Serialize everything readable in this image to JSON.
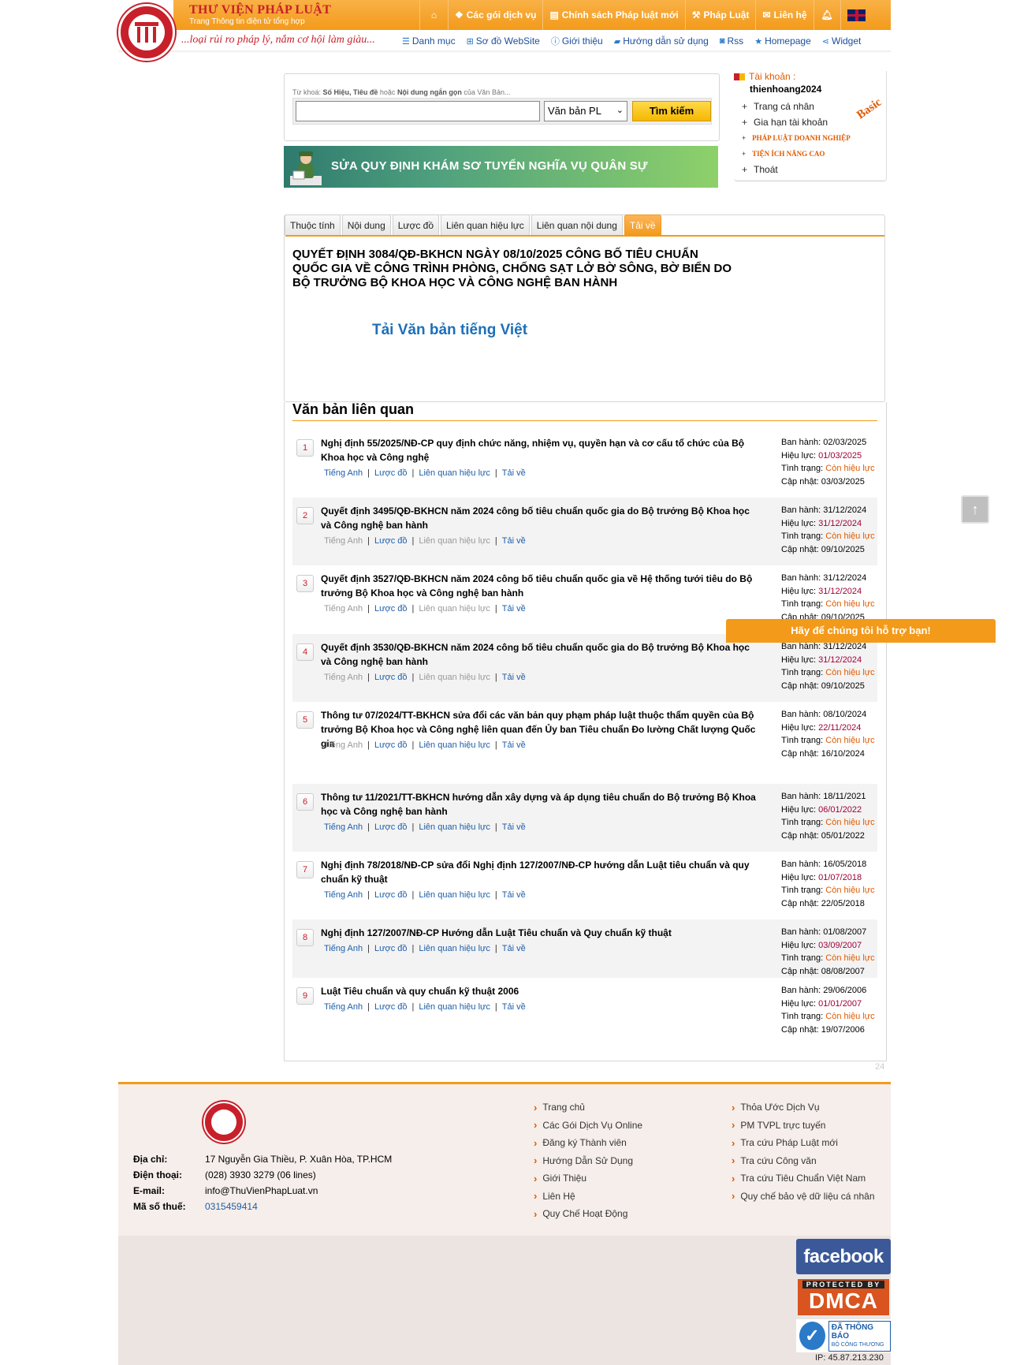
{
  "header": {
    "brand_title": "THƯ VIỆN PHÁP LUẬT",
    "brand_sub": "Trang Thông tin điện tử tổng hợp",
    "slogan": "...loại rủi ro pháp lý, nắm cơ hội làm giàu...",
    "topnav": [
      {
        "label": "",
        "icon": "home-icon"
      },
      {
        "label": "Các gói dịch vụ",
        "icon": "dropbox-icon"
      },
      {
        "label": "Chính sách Pháp luật mới",
        "icon": "news-icon"
      },
      {
        "label": "Pháp Luật",
        "icon": "gavel-icon"
      },
      {
        "label": "Liên hệ",
        "icon": "mail-icon"
      },
      {
        "label": "",
        "icon": "bell-icon"
      },
      {
        "label": "",
        "icon": "uk-flag-icon"
      }
    ],
    "subnav": [
      {
        "label": "Danh mục",
        "icon": "list-icon"
      },
      {
        "label": "Sơ đồ WebSite",
        "icon": "sitemap-icon"
      },
      {
        "label": "Giới thiệu",
        "icon": "info-icon"
      },
      {
        "label": "Hướng dẫn sử dụng",
        "icon": "book-icon"
      },
      {
        "label": "Rss",
        "icon": "rss-icon"
      },
      {
        "label": "Homepage",
        "icon": "star-icon"
      },
      {
        "label": "Widget",
        "icon": "share-icon"
      }
    ]
  },
  "search": {
    "hint_prefix": "Từ khoá: ",
    "hint_bold": "Số Hiệu, Tiêu đề",
    "hint_mid": " hoặc ",
    "hint_bold2": "Nội dung ngắn gọn",
    "hint_suffix": " của Văn Bản...",
    "value": "",
    "select_value": "Văn bản PL",
    "button_label": "Tìm kiếm"
  },
  "banner": {
    "text": "SỬA QUY ĐỊNH KHÁM SƠ TUYỂN NGHĨA VỤ QUÂN SỰ"
  },
  "account": {
    "label": "Tài khoản :",
    "username": "thienhoang2024",
    "badge": "Basic",
    "menu": [
      {
        "label": "Trang cá nhân",
        "style": "normal"
      },
      {
        "label": "Gia hạn tài khoản",
        "style": "normal"
      },
      {
        "label": "PHÁP LUẬT DOANH NGHIỆP",
        "style": "red"
      },
      {
        "label": "TIỆN ÍCH NÂNG CAO",
        "style": "red"
      },
      {
        "label": "Thoát",
        "style": "normal"
      }
    ]
  },
  "tabs": [
    {
      "label": "Thuộc tính",
      "active": false
    },
    {
      "label": "Nội dung",
      "active": false
    },
    {
      "label": "Lược đồ",
      "active": false
    },
    {
      "label": "Liên quan hiệu lực",
      "active": false
    },
    {
      "label": "Liên quan nội dung",
      "active": false
    },
    {
      "label": "Tải về",
      "active": true
    }
  ],
  "document": {
    "title": "QUYẾT ĐỊNH 3084/QĐ-BKHCN NGÀY 08/10/2025 CÔNG BỐ TIÊU CHUẨN QUỐC GIA VỀ CÔNG TRÌNH PHÒNG, CHỐNG SẠT LỞ BỜ SÔNG, BỜ BIỂN DO BỘ TRƯỞNG BỘ KHOA HỌC VÀ CÔNG NGHỆ BAN HÀNH",
    "download_label": "Tải Văn bản tiếng Việt"
  },
  "related": {
    "heading": "Văn bản liên quan",
    "meta_labels": {
      "issued": "Ban hành:",
      "effective": "Hiệu lực:",
      "status": "Tình trạng:",
      "updated": "Cập nhật:"
    },
    "link_labels": {
      "en": "Tiếng Anh",
      "diagram": "Lược đồ",
      "effect": "Liên quan hiệu lực",
      "download": "Tải về"
    },
    "items": [
      {
        "num": "1",
        "title": "Nghị định 55/2025/NĐ-CP quy định chức năng, nhiệm vụ, quyền hạn và cơ cấu tổ chức của Bộ Khoa học và Công nghệ",
        "issued": "02/03/2025",
        "effective": "01/03/2025",
        "status": "Còn hiệu lực",
        "updated": "03/03/2025",
        "en_dim": false,
        "effect_dim": false
      },
      {
        "num": "2",
        "title": "Quyết định 3495/QĐ-BKHCN năm 2024 công bố tiêu chuẩn quốc gia do Bộ trưởng Bộ Khoa học và Công nghệ ban hành",
        "issued": "31/12/2024",
        "effective": "31/12/2024",
        "status": "Còn hiệu lực",
        "updated": "09/10/2025",
        "en_dim": true,
        "effect_dim": true
      },
      {
        "num": "3",
        "title": "Quyết định 3527/QĐ-BKHCN năm 2024 công bố tiêu chuẩn quốc gia về Hệ thống tưới tiêu do Bộ trưởng Bộ Khoa học và Công nghệ ban hành",
        "issued": "31/12/2024",
        "effective": "31/12/2024",
        "status": "Còn hiệu lực",
        "updated": "09/10/2025",
        "en_dim": true,
        "effect_dim": true
      },
      {
        "num": "4",
        "title": "Quyết định 3530/QĐ-BKHCN năm 2024 công bố tiêu chuẩn quốc gia do Bộ trưởng Bộ Khoa học và Công nghệ ban hành",
        "issued": "31/12/2024",
        "effective": "31/12/2024",
        "status": "Còn hiệu lực",
        "updated": "09/10/2025",
        "en_dim": true,
        "effect_dim": true
      },
      {
        "num": "5",
        "title": "Thông tư 07/2024/TT-BKHCN sửa đổi các văn bản quy phạm pháp luật thuộc thẩm quyền của Bộ trưởng Bộ Khoa học và Công nghệ liên quan đến Ủy ban Tiêu chuẩn Đo lường Chất lượng Quốc gia",
        "issued": "08/10/2024",
        "effective": "22/11/2024",
        "status": "Còn hiệu lực",
        "updated": "16/10/2024",
        "en_dim": true,
        "effect_dim": false
      },
      {
        "num": "6",
        "title": "Thông tư 11/2021/TT-BKHCN hướng dẫn xây dựng và áp dụng tiêu chuẩn do Bộ trưởng Bộ Khoa học và Công nghệ ban hành",
        "issued": "18/11/2021",
        "effective": "06/01/2022",
        "status": "Còn hiệu lực",
        "updated": "05/01/2022",
        "en_dim": false,
        "effect_dim": false
      },
      {
        "num": "7",
        "title": "Nghị định 78/2018/NĐ-CP sửa đổi Nghị định 127/2007/NĐ-CP hướng dẫn Luật tiêu chuẩn và quy chuẩn kỹ thuật",
        "issued": "16/05/2018",
        "effective": "01/07/2018",
        "status": "Còn hiệu lực",
        "updated": "22/05/2018",
        "en_dim": false,
        "effect_dim": false
      },
      {
        "num": "8",
        "title": "Nghị định 127/2007/NĐ-CP Hướng dẫn Luật Tiêu chuẩn và Quy chuẩn kỹ thuật",
        "issued": "01/08/2007",
        "effective": "03/09/2007",
        "status": "Còn hiệu lực",
        "updated": "08/08/2007",
        "en_dim": false,
        "effect_dim": false
      },
      {
        "num": "9",
        "title": "Luật Tiêu chuẩn và quy chuẩn kỹ thuật 2006",
        "issued": "29/06/2006",
        "effective": "01/01/2007",
        "status": "Còn hiệu lực",
        "updated": "19/07/2006",
        "en_dim": false,
        "effect_dim": false
      }
    ],
    "page_counter": "24"
  },
  "floating": {
    "support_label": "Hãy để chúng tôi hỗ trợ bạn!",
    "scroll_top_icon": "arrow-up-icon"
  },
  "footer": {
    "contact": [
      {
        "key": "Địa chỉ:",
        "value": "17 Nguyễn Gia Thiều, P. Xuân Hòa, TP.HCM",
        "link": false
      },
      {
        "key": "Điện thoại:",
        "value": "(028) 3930 3279 (06 lines)",
        "link": false
      },
      {
        "key": "E-mail:",
        "value": "info@ThuVienPhapLuat.vn",
        "link": false
      },
      {
        "key": "Mã số thuế:",
        "value": "0315459414",
        "link": true
      }
    ],
    "col1": [
      "Trang chủ",
      "Các Gói Dịch Vụ Online",
      "Đăng ký Thành viên",
      "Hướng Dẫn Sử Dụng",
      "Giới Thiệu",
      "Liên Hệ",
      "Quy Chế Hoạt Động"
    ],
    "col2": [
      "Thỏa Ước Dịch Vụ",
      "PM TVPL trực tuyến",
      "Tra cứu Pháp Luật mới",
      "Tra cứu Công văn",
      "Tra cứu Tiêu Chuẩn Việt Nam",
      "Quy chế bảo vệ dữ liệu cá nhân"
    ],
    "facebook_label": "facebook",
    "dmca_top": "PROTECTED BY",
    "dmca_big": "DMCA",
    "bct_line1": "ĐÃ THÔNG BÁO",
    "bct_line2": "BỘ CÔNG THƯƠNG",
    "ip": "IP: 45.87.213.230"
  }
}
